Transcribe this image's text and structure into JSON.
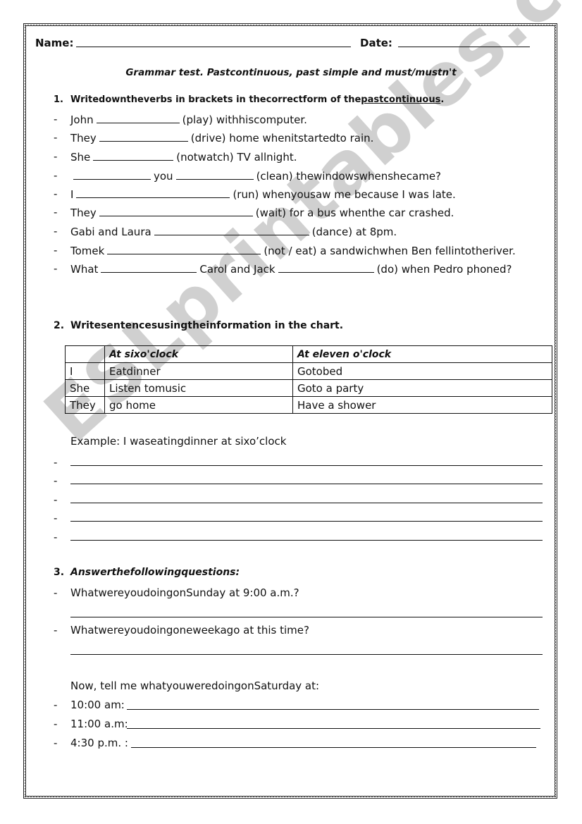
{
  "header": {
    "name_label": "Name:",
    "date_label": "Date:",
    "title": "Grammar test. Pastcontinuous, past simple and must/mustn't"
  },
  "section1": {
    "number": "1.",
    "instruction_prefix": "Writedowntheverbs in brackets in thecorrectform of the",
    "instruction_underlined": "pastcontinuous",
    "instruction_suffix": ".",
    "items": [
      {
        "before": "John",
        "mid": "",
        "after": "(play) withhiscomputer."
      },
      {
        "before": "They",
        "mid": "",
        "after": "(drive) home whenitstartedto rain."
      },
      {
        "before": "She",
        "mid": "",
        "after": "(notwatch) TV allnight."
      },
      {
        "before": "",
        "mid": "you",
        "after": "(clean) thewindowswhenshecame?"
      },
      {
        "before": "I",
        "mid": "",
        "after": "(run) whenyousaw me because I was late."
      },
      {
        "before": "They",
        "mid": "",
        "after": "(wait) for a bus whenthe car crashed."
      },
      {
        "before": "Gabi and Laura",
        "mid": "",
        "after": "(dance) at 8pm."
      },
      {
        "before": "Tomek",
        "mid": "",
        "after": "(not / eat) a sandwichwhen Ben fellintotheriver."
      },
      {
        "before": "What",
        "mid": "Carol and Jack",
        "after": "(do) when Pedro phoned?"
      }
    ]
  },
  "section2": {
    "number": "2.",
    "instruction": "Writesentencesusingtheinformation in the chart.",
    "table": {
      "headers": [
        "",
        "At sixo'clock",
        "At eleven o'clock"
      ],
      "rows": [
        [
          "I",
          "Eatdinner",
          "Gotobed"
        ],
        [
          "She",
          "Listen tomusic",
          "Goto a party"
        ],
        [
          "They",
          "go home",
          "Have a shower"
        ]
      ]
    },
    "example": "Example: I waseatingdinner at sixo’clock"
  },
  "section3": {
    "number": "3.",
    "instruction": "Answerthefollowingquestions:",
    "questions": [
      "WhatwereyoudoingonSunday at 9:00 a.m.?",
      "Whatwereyoudoingoneweekago at this time?"
    ],
    "prompt": "Now, tell me whatyouweredoingonSaturday at:",
    "times": [
      "10:00 am:",
      "11:00 a.m:",
      "4:30 p.m. :"
    ]
  },
  "dash": "-",
  "watermark": "ESLprintables.com"
}
